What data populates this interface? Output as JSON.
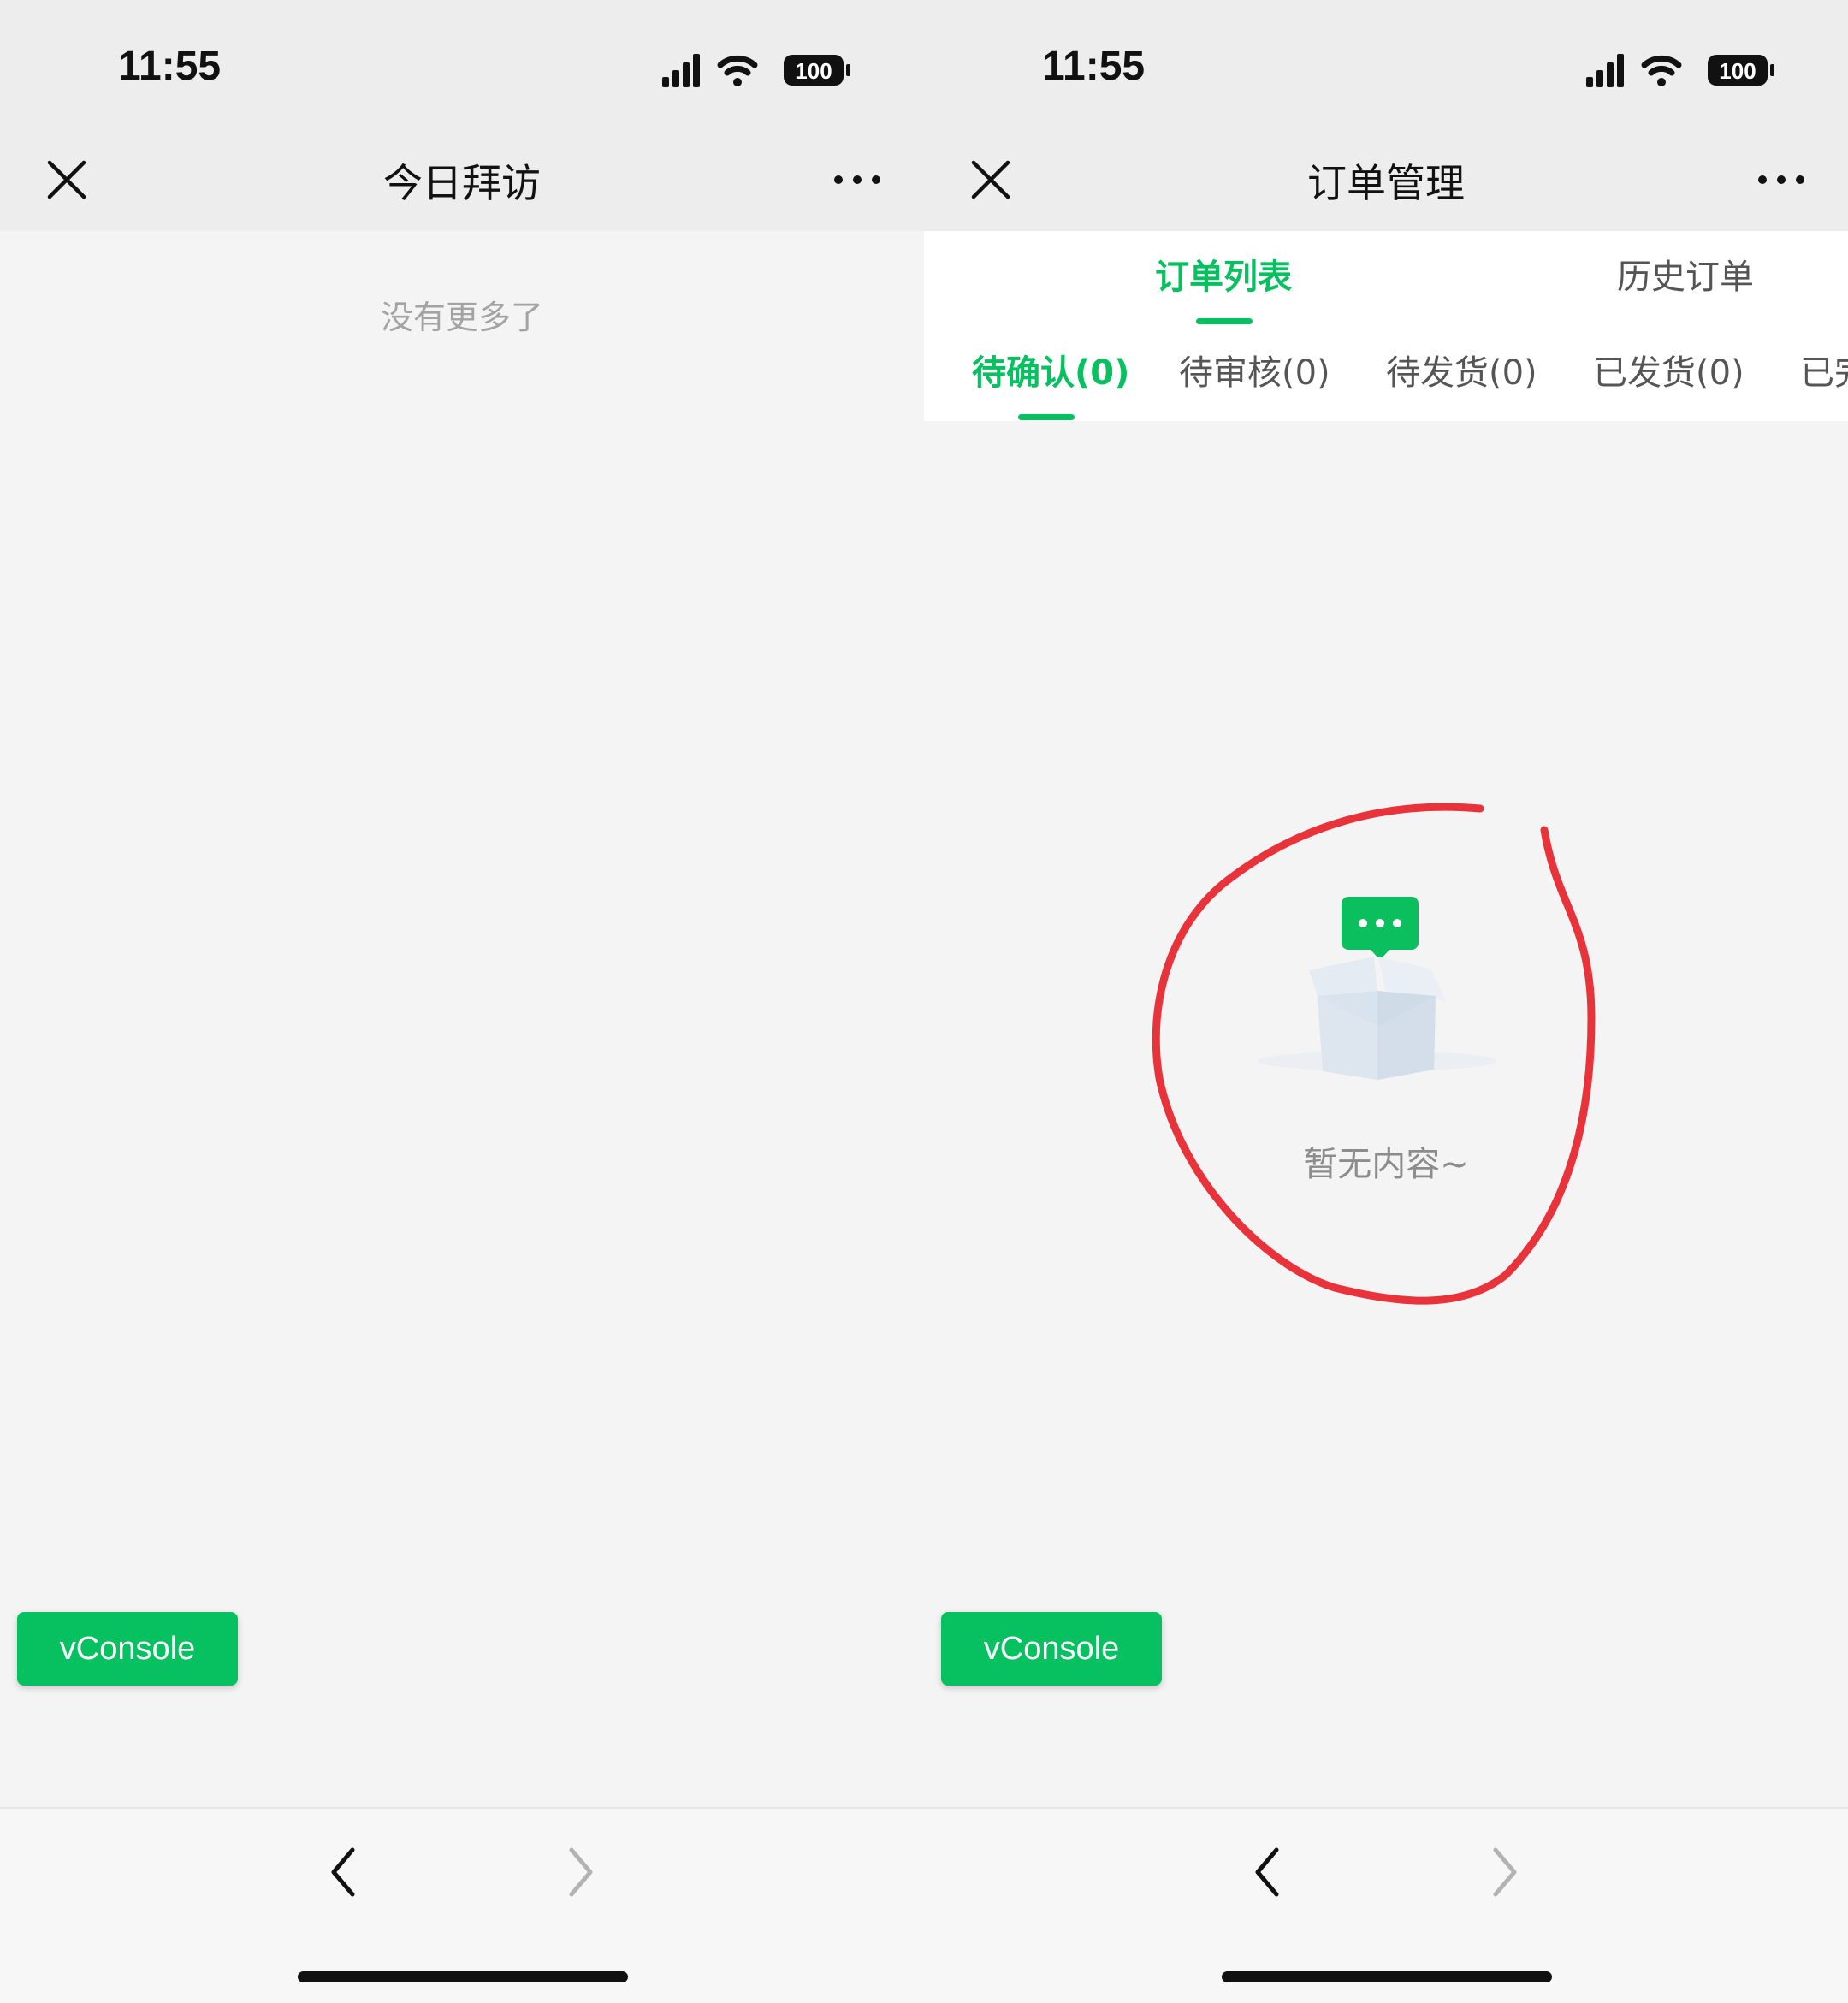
{
  "screens": [
    {
      "status_time": "11:55",
      "battery": "100",
      "title": "今日拜访",
      "list_end_text": "没有更多了",
      "vconsole_label": "vConsole"
    },
    {
      "status_time": "11:55",
      "battery": "100",
      "title": "订单管理",
      "main_tabs": [
        "订单列表",
        "历史订单"
      ],
      "active_main_tab": 0,
      "sub_tabs": [
        "待确认(0)",
        "待审核(0)",
        "待发货(0)",
        "已发货(0)",
        "已完"
      ],
      "active_sub_tab": 0,
      "empty_text": "暂无内容~",
      "vconsole_label": "vConsole"
    }
  ],
  "icons": {
    "close": "close-icon",
    "more": "more-icon",
    "signal": "signal-icon",
    "wifi": "wifi-icon",
    "battery": "battery-icon",
    "back": "chevron-left-icon",
    "forward": "chevron-right-icon",
    "empty_state": "empty-box-icon"
  },
  "colors": {
    "accent": "#07c160",
    "annotation": "#e8333a",
    "page_bg": "#f4f4f4",
    "header_bg": "#ededed"
  }
}
